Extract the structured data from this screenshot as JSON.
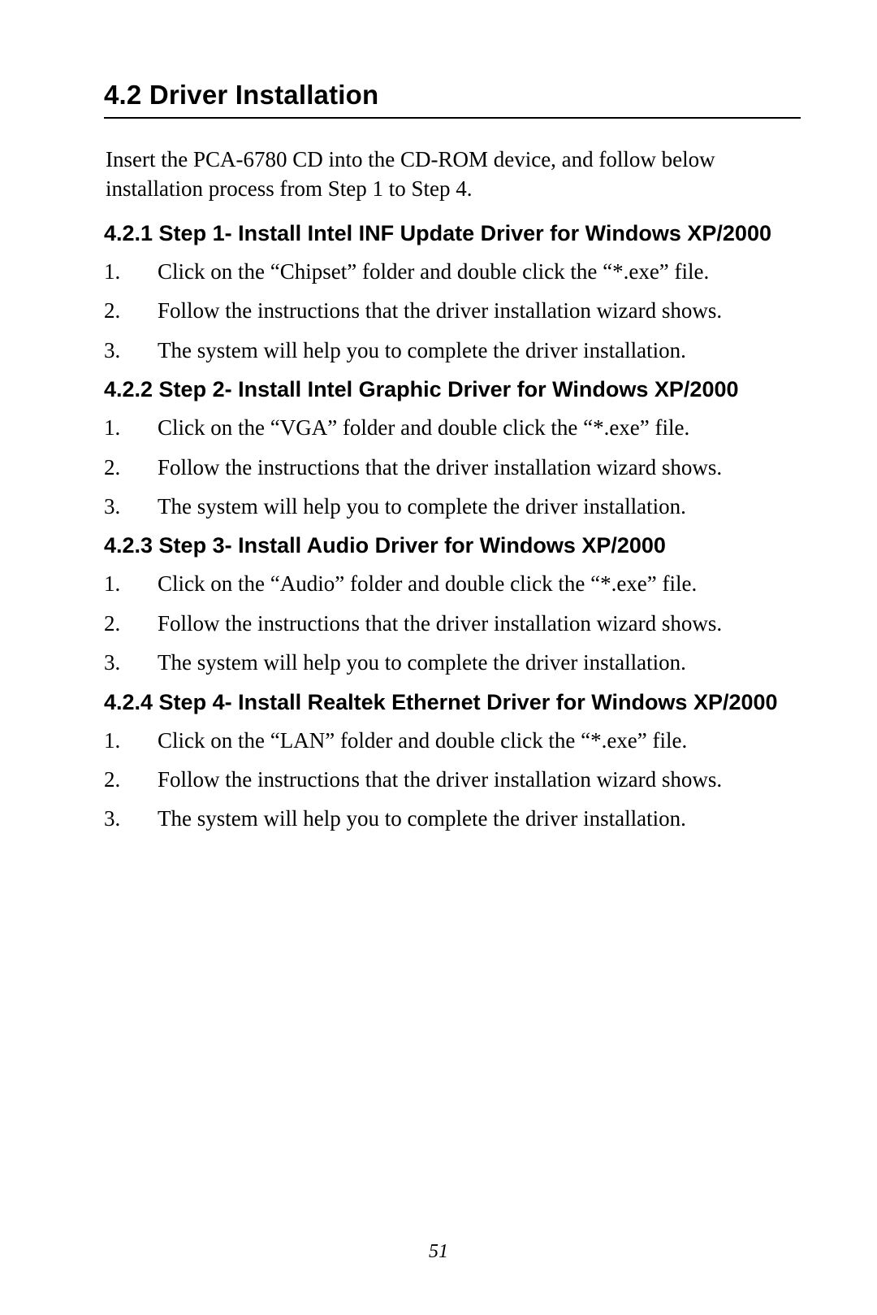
{
  "section": {
    "title": "4.2  Driver Installation",
    "intro": "Insert the PCA-6780 CD into the CD-ROM device, and follow below installation process from Step 1 to Step 4."
  },
  "subsections": [
    {
      "heading": "4.2.1 Step 1- Install Intel INF Update Driver for Windows XP/2000",
      "items": [
        {
          "num": "1.",
          "text": "Click on the “Chipset” folder and double click the “*.exe” file."
        },
        {
          "num": "2.",
          "text": "Follow the instructions that the driver installation wizard shows."
        },
        {
          "num": "3.",
          "text": "The system will help you to complete the driver installation."
        }
      ]
    },
    {
      "heading": "4.2.2 Step 2- Install Intel Graphic Driver for Windows XP/2000",
      "items": [
        {
          "num": "1.",
          "text": "Click on the “VGA” folder and double click the “*.exe” file."
        },
        {
          "num": "2.",
          "text": " Follow the instructions that the driver installation wizard shows."
        },
        {
          "num": "3.",
          "text": "The system will help you to complete the driver installation."
        }
      ]
    },
    {
      "heading": "4.2.3 Step 3- Install Audio Driver for Windows XP/2000",
      "items": [
        {
          "num": "1.",
          "text": "Click on the “Audio” folder and double click the “*.exe” file."
        },
        {
          "num": "2.",
          "text": "Follow the instructions that the driver installation wizard shows."
        },
        {
          "num": "3.",
          "text": "The system will help you to complete the driver installation."
        }
      ]
    },
    {
      "heading": "4.2.4 Step 4- Install Realtek Ethernet Driver for Windows XP/2000",
      "items": [
        {
          "num": "1.",
          "text": "Click on the “LAN” folder and double click the “*.exe” file."
        },
        {
          "num": "2.",
          "text": "Follow the instructions that the driver installation wizard shows."
        },
        {
          "num": "3.",
          "text": "The system will help you to complete the driver installation."
        }
      ]
    }
  ],
  "page_number": "51"
}
